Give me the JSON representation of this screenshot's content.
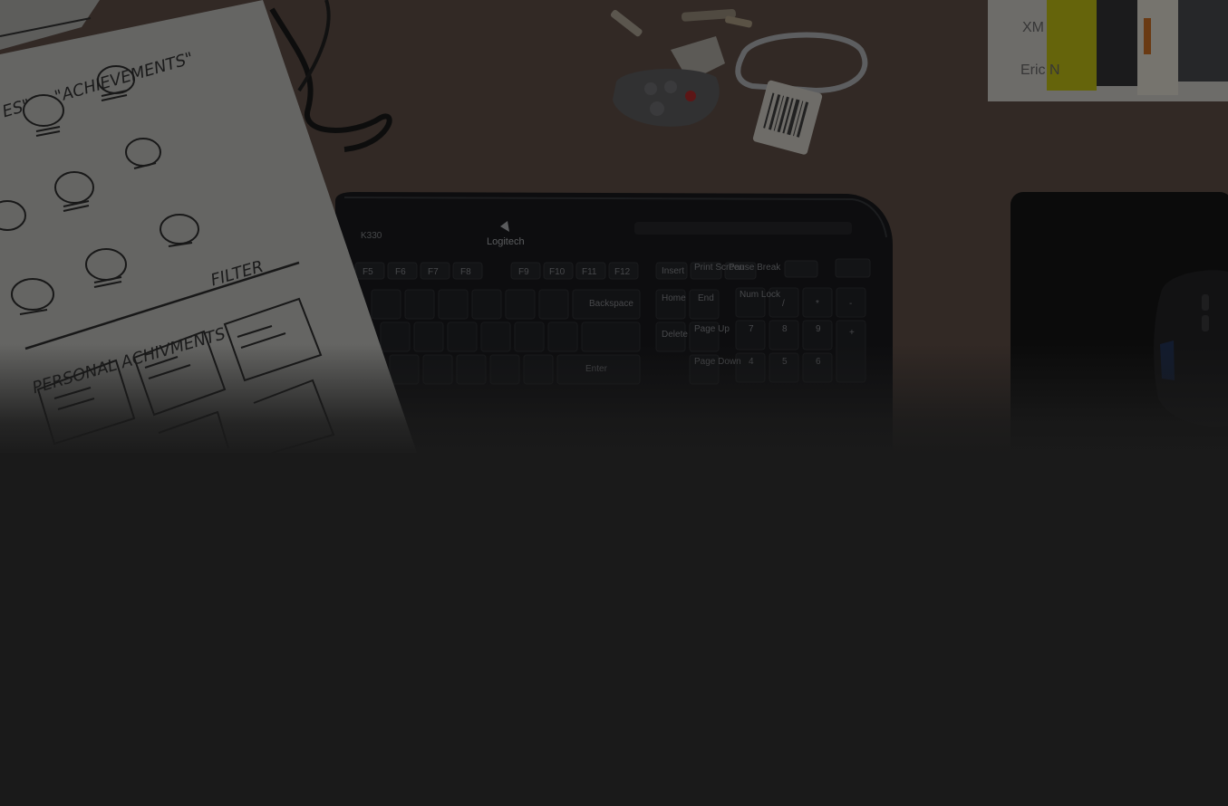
{
  "scene": {
    "description_visible_text": {
      "sketch_heading": "\"ACHIEVEMENTS\"",
      "sketch_heading_left": "ES\"",
      "sketch_section_a": "PERSONAL ACHIVMENTS",
      "sketch_section_b": "FILTER",
      "keyboard_model": "K330",
      "keyboard_brand": "Logitech",
      "book_title": "XM",
      "book_author": "Eric N"
    },
    "keyboard_keys_row1": [
      "F5",
      "F6",
      "F7",
      "F8",
      "F9",
      "F10",
      "F11",
      "F12",
      "Insert",
      "Print Screen",
      "Pause Break"
    ],
    "keyboard_keys_row2": [
      "Backspace",
      "Home",
      "End",
      "Num Lock",
      "/",
      "*",
      "-"
    ],
    "keyboard_keys_row3": [
      "Delete",
      "Page Up",
      "7",
      "8",
      "9",
      "+"
    ],
    "keyboard_keys_row4": [
      "Enter",
      "Page Down",
      "4",
      "5",
      "6"
    ],
    "colors": {
      "desk": "#5a4a40",
      "overlay": "#1a1a1a",
      "paper": "#9a9a98",
      "keyboard": "#151618",
      "mousepad": "#121212"
    },
    "icons": [
      "keys-icon",
      "car-remote-icon",
      "carabiner-icon",
      "mouse-icon"
    ]
  }
}
